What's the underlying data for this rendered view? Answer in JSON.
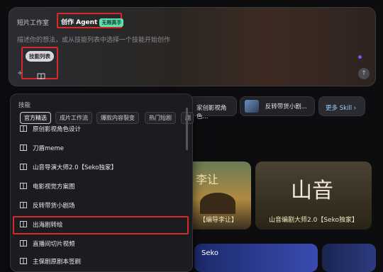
{
  "composer": {
    "tab_studio": "短片工作室",
    "tab_agent": "创作 Agent",
    "badge": "无限高手",
    "placeholder": "描述你的想法，或从技能列表中选择一个技能开始创作",
    "skill_list_chip": "技能列表",
    "add_icon": "plus",
    "send_icon": "arrow-up"
  },
  "skill_cards": [
    {
      "label": "家创影视角色..."
    },
    {
      "label": "反转带货小剧..."
    },
    {
      "label": "更多 Skill ›"
    }
  ],
  "posters": [
    {
      "caption": "【编导李让】",
      "title": "李让"
    },
    {
      "caption": "山音编剧大师2.0【Seko独家】",
      "title": "山音"
    },
    {
      "caption": "",
      "title": "Seko"
    }
  ],
  "dropdown": {
    "title": "技能",
    "filters": [
      "官方精选",
      "成片工作流",
      "爆款内容裂变",
      "热门短剧",
      "剧"
    ],
    "items": [
      "原创影视角色设计",
      "刀盾meme",
      "山音导演大师2.0【Seko独家】",
      "电影视觉方案图",
      "反转带货小剧场",
      "出海剧转绘",
      "直播间切片视频",
      "主保剧原剧本签刷"
    ]
  },
  "colors": {
    "accent_red": "#d62a2a",
    "badge_green": "#5fe0b0"
  }
}
